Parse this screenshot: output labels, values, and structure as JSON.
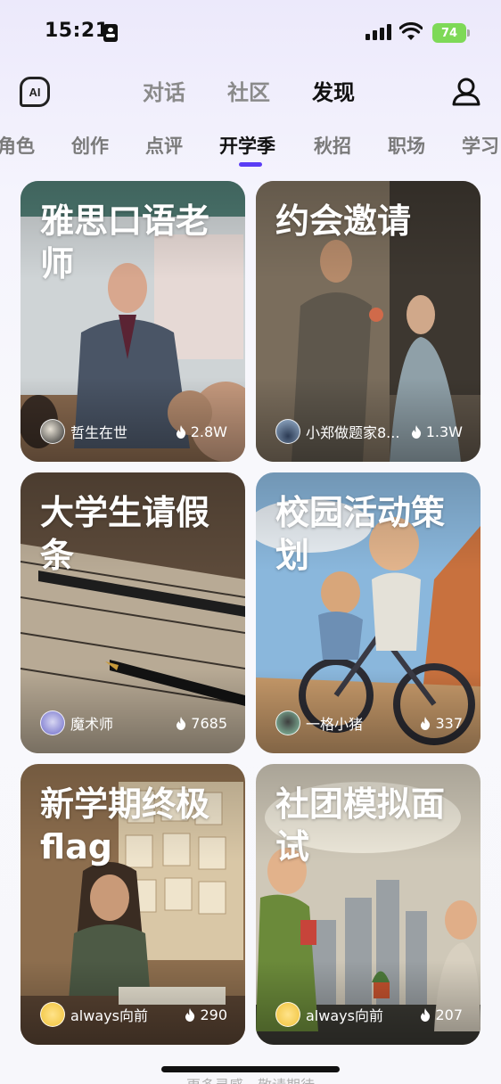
{
  "status": {
    "time": "15:21",
    "battery": "74"
  },
  "header": {
    "logo_text": "AI",
    "tabs": [
      {
        "label": "对话",
        "active": false
      },
      {
        "label": "社区",
        "active": false
      },
      {
        "label": "发现",
        "active": true
      }
    ]
  },
  "categories": [
    "角色",
    "创作",
    "点评",
    "开学季",
    "秋招",
    "职场",
    "学习"
  ],
  "active_category": "开学季",
  "cards": [
    {
      "title": "雅思口语老师",
      "author": "哲生在世",
      "views": "2.8W"
    },
    {
      "title": "约会邀请",
      "author": "小郑做题家8...",
      "views": "1.3W"
    },
    {
      "title": "大学生请假条",
      "author": "魔术师",
      "views": "7685"
    },
    {
      "title": "校园活动策划",
      "author": "一格小猪",
      "views": "337"
    },
    {
      "title": "新学期终极flag",
      "author": "always向前",
      "views": "290"
    },
    {
      "title": "社团模拟面试",
      "author": "always向前",
      "views": "207"
    }
  ],
  "footer_hint": "更多灵感，敬请期待",
  "icons": [
    "logo-icon",
    "profile-icon",
    "flame-icon",
    "signal-icon",
    "wifi-icon",
    "battery-icon"
  ]
}
